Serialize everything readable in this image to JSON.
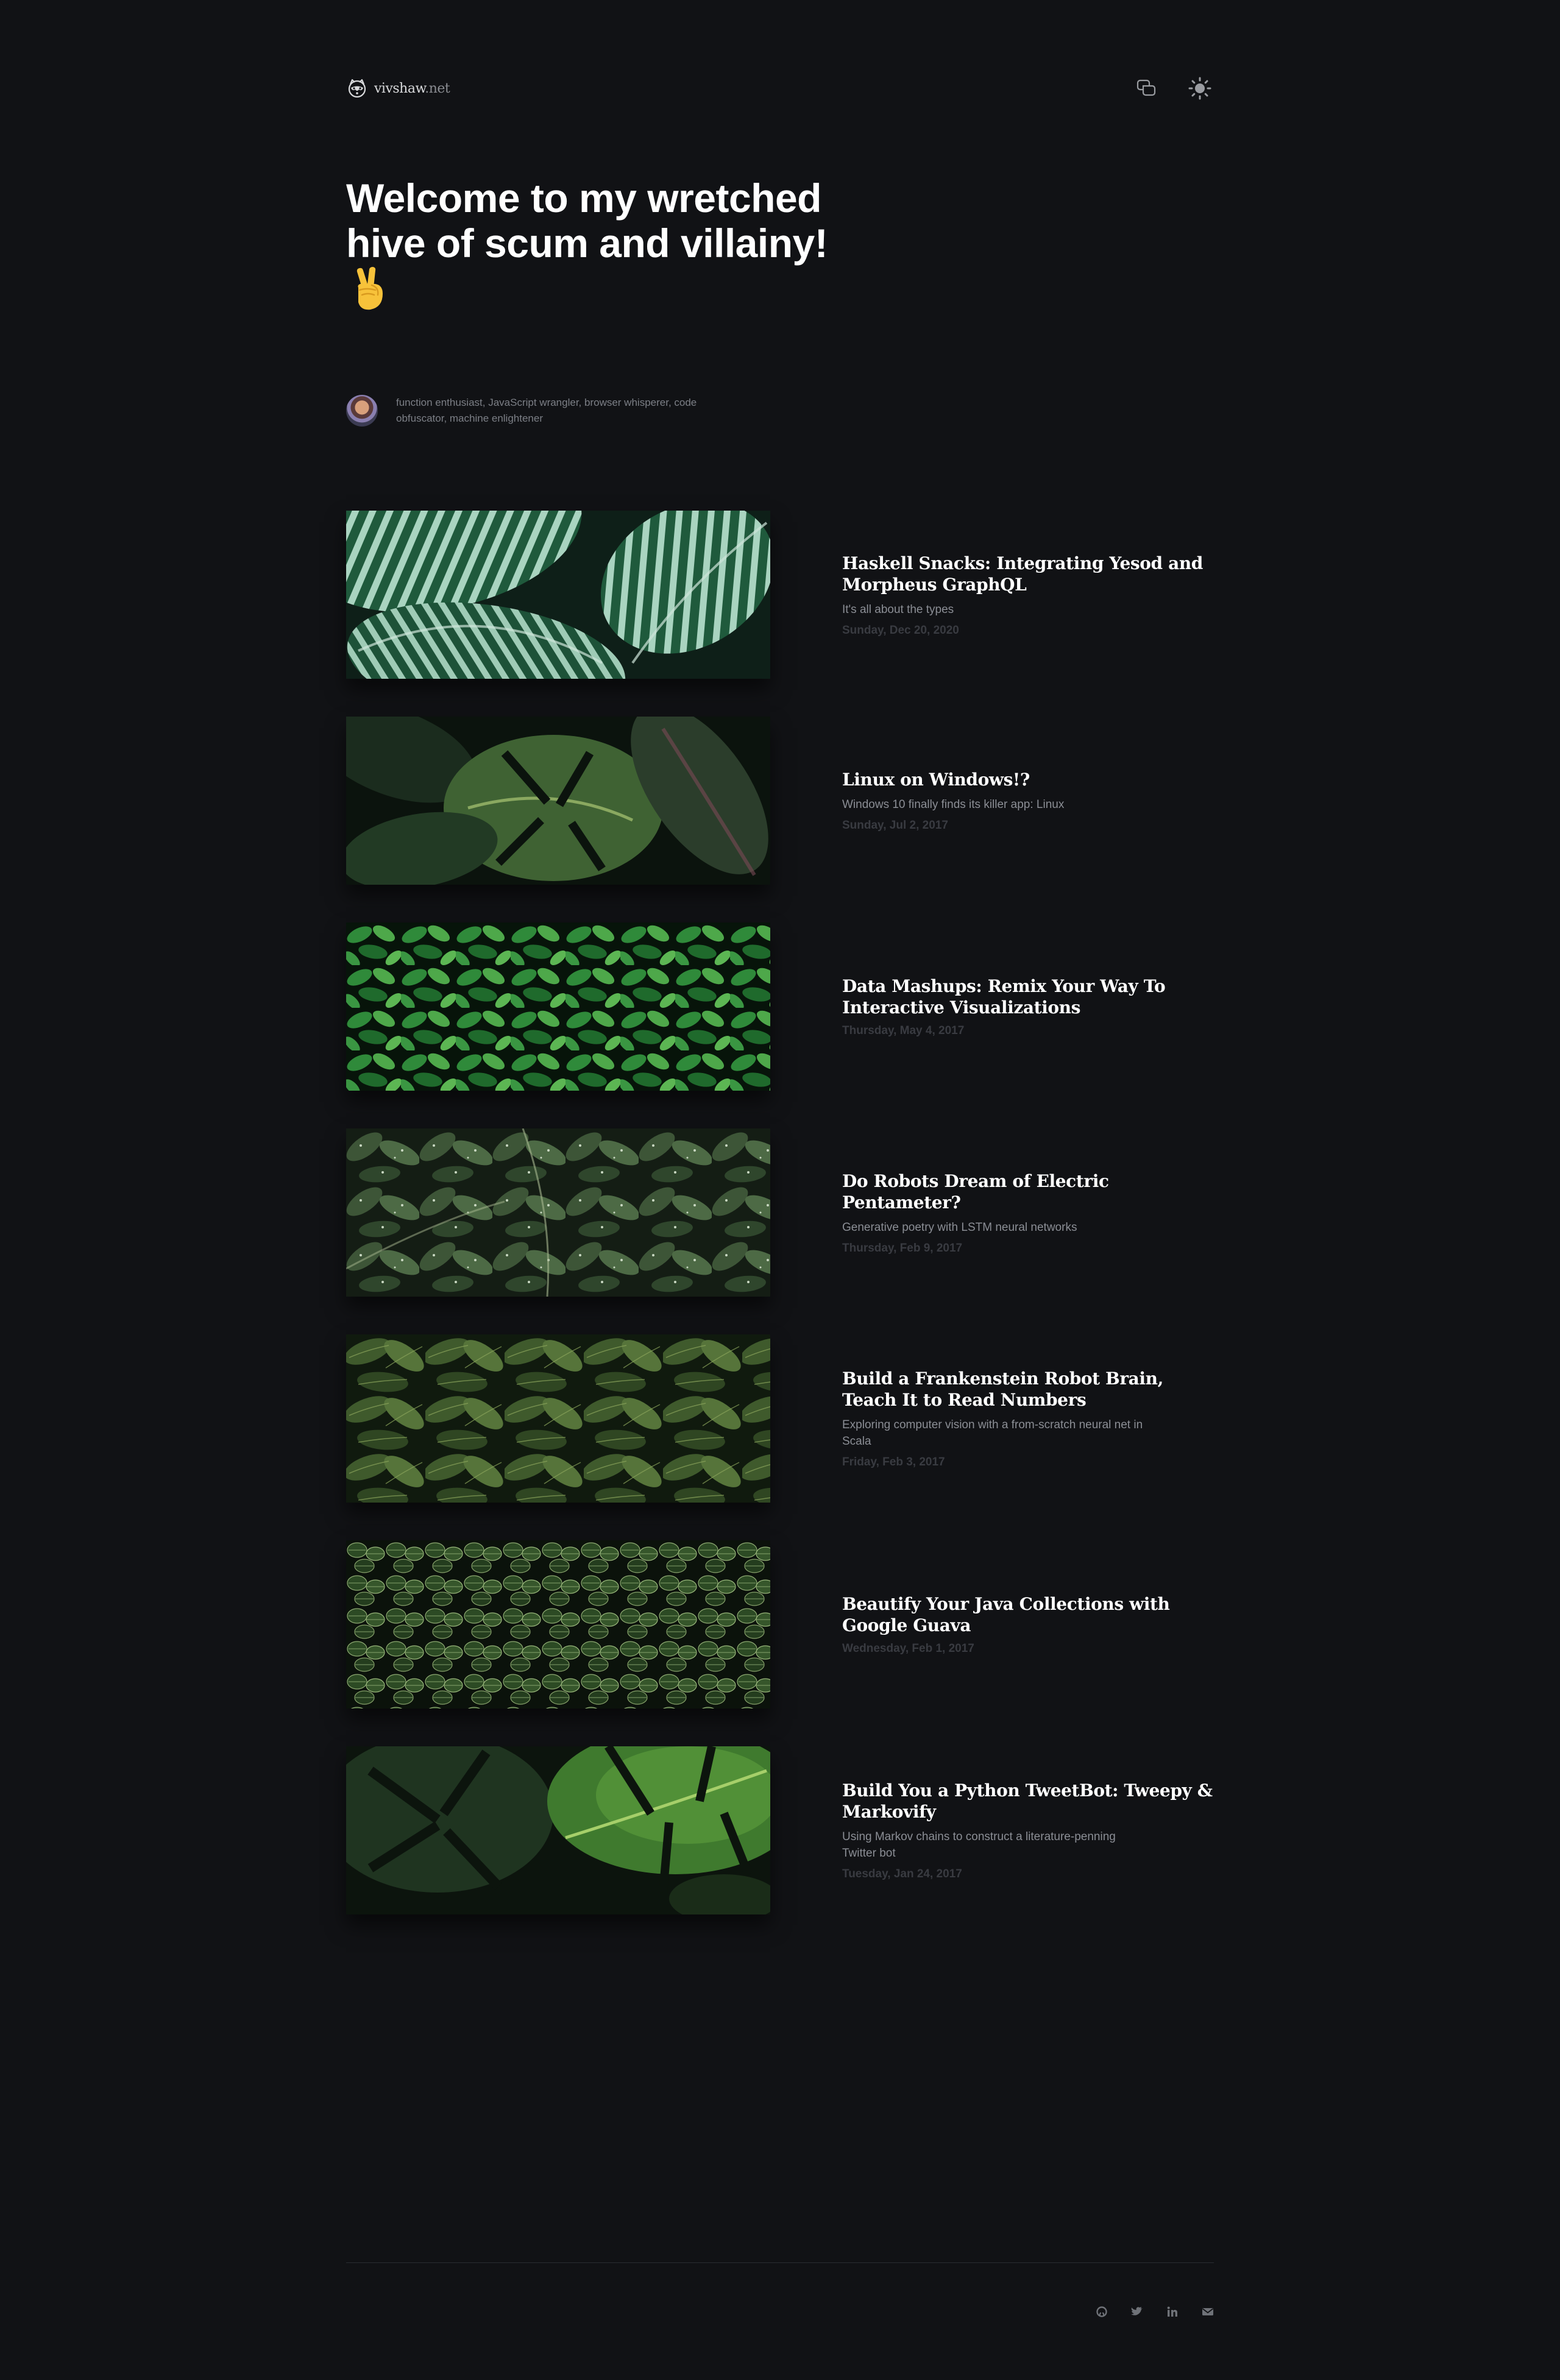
{
  "header": {
    "brand_name": "vivshaw",
    "brand_tld": ".net",
    "logo_icon": "raccoon-face-icon",
    "chat_icon": "chat-bubbles-icon",
    "theme_icon": "sun-icon"
  },
  "hero": {
    "title": "Welcome to my wretched hive of scum and villainy!",
    "emoji": "victory-hand-emoji"
  },
  "bio": {
    "text": "function enthusiast, JavaScript wrangler, browser whisperer, code obfuscator, machine enlightener"
  },
  "posts": [
    {
      "title": "Haskell Snacks: Integrating Yesod and Morpheus GraphQL",
      "subtitle": "It's all about the types",
      "date": "Sunday, Dec 20, 2020",
      "image": "striped-calathea-leaves"
    },
    {
      "title": "Linux on Windows!?",
      "subtitle": "Windows 10 finally finds its killer app: Linux",
      "date": "Sunday, Jul 2, 2017",
      "image": "monstera-leaves"
    },
    {
      "title": "Data Mashups: Remix Your Way To Interactive Visualizations",
      "subtitle": "",
      "date": "Thursday, May 4, 2017",
      "image": "bright-green-shrub"
    },
    {
      "title": "Do Robots Dream of Electric Pentameter?",
      "subtitle": "Generative poetry with LSTM neural networks",
      "date": "Thursday, Feb 9, 2017",
      "image": "wet-leaves"
    },
    {
      "title": "Build a Frankenstein Robot Brain, Teach It to Read Numbers",
      "subtitle": "Exploring computer vision with a from-scratch neural net in Scala",
      "date": "Friday, Feb 3, 2017",
      "image": "hosta-leaves"
    },
    {
      "title": "Beautify Your Java Collections with Google Guava",
      "subtitle": "",
      "date": "Wednesday, Feb 1, 2017",
      "image": "fittonia-leaves"
    },
    {
      "title": "Build You a Python TweetBot: Tweepy & Markovify",
      "subtitle": "Using Markov chains to construct a literature-penning Twitter bot",
      "date": "Tuesday, Jan 24, 2017",
      "image": "monstera-closeup"
    }
  ],
  "footer": {
    "social": [
      "github-icon",
      "twitter-icon",
      "linkedin-icon",
      "mail-icon"
    ]
  },
  "colors": {
    "background": "#111215",
    "text_primary": "#ffffff",
    "text_secondary": "#8b8e95",
    "text_muted": "#393b41"
  }
}
